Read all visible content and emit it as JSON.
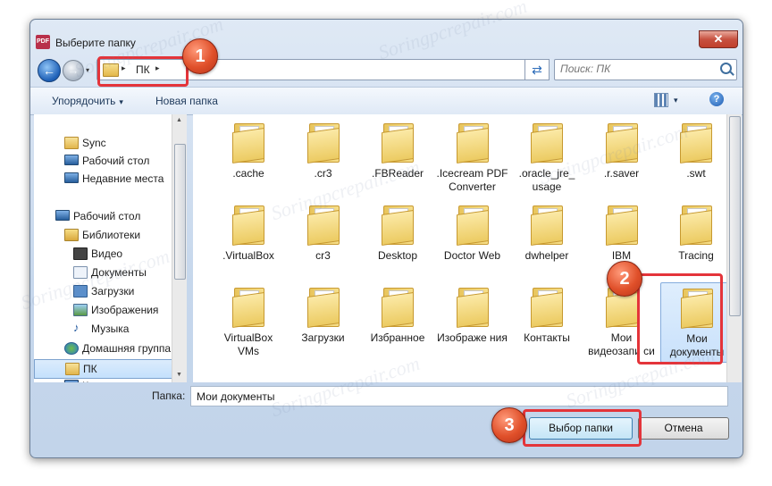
{
  "window": {
    "title": "Выберите папку",
    "close_label": "✕",
    "app_icon_text": "PDF"
  },
  "address": {
    "crumb": "ПК",
    "sep1": "▸",
    "sep2": "▸",
    "dropdown": "▾"
  },
  "search": {
    "placeholder": "Поиск: ПК"
  },
  "toolbar": {
    "organize_label": "Упорядочить",
    "organize_caret": "▾",
    "new_folder_label": "Новая папка",
    "help_label": "?"
  },
  "nav": {
    "items": [
      {
        "label": "Sync",
        "icon": "folder-icon"
      },
      {
        "label": "Рабочий стол",
        "icon": "desktop-icon"
      },
      {
        "label": "Недавние места",
        "icon": "recent-places-icon"
      },
      {
        "label": "Рабочий стол",
        "icon": "desktop-icon"
      },
      {
        "label": "Библиотеки",
        "icon": "libraries-icon"
      },
      {
        "label": "Видео",
        "icon": "video-icon"
      },
      {
        "label": "Документы",
        "icon": "documents-icon"
      },
      {
        "label": "Загрузки",
        "icon": "downloads-icon"
      },
      {
        "label": "Изображения",
        "icon": "pictures-icon"
      },
      {
        "label": "Музыка",
        "icon": "music-icon"
      },
      {
        "label": "Домашняя группа",
        "icon": "homegroup-icon"
      },
      {
        "label": "ПК",
        "icon": "pc-icon"
      },
      {
        "label": "Компьютер",
        "icon": "computer-icon"
      }
    ],
    "selected": "ПК"
  },
  "files": [
    {
      "label": ".cache"
    },
    {
      "label": ".cr3"
    },
    {
      "label": ".FBReader"
    },
    {
      "label": ".Icecream PDF Converter"
    },
    {
      "label": ".oracle_jre_ usage"
    },
    {
      "label": ".r.saver"
    },
    {
      "label": ".swt"
    },
    {
      "label": ".VirtualBox"
    },
    {
      "label": "cr3"
    },
    {
      "label": "Desktop"
    },
    {
      "label": "Doctor Web"
    },
    {
      "label": "dwhelper"
    },
    {
      "label": "IBM"
    },
    {
      "label": "Tracing"
    },
    {
      "label": "VirtualBox VMs"
    },
    {
      "label": "Загрузки"
    },
    {
      "label": "Избранное"
    },
    {
      "label": "Изображе ния"
    },
    {
      "label": "Контакты"
    },
    {
      "label": "Мои видеозапи си"
    },
    {
      "label": "Мои документы"
    }
  ],
  "selected_file": "Мои документы",
  "footer": {
    "folder_label": "Папка:",
    "folder_value": "Мои документы",
    "select_button": "Выбор папки",
    "cancel_button": "Отмена"
  },
  "annotations": {
    "badge1": "1",
    "badge2": "2",
    "badge3": "3",
    "highlight_color": "#e4343a"
  },
  "watermark": "Soringpcrepair.com"
}
